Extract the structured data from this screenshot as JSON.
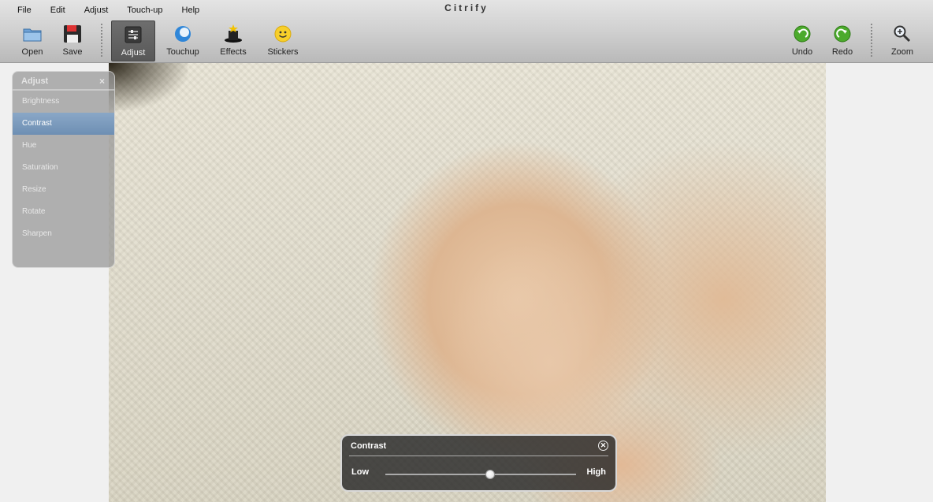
{
  "app": {
    "title": "Citrify"
  },
  "menu": [
    "File",
    "Edit",
    "Adjust",
    "Touch-up",
    "Help"
  ],
  "toolbar": {
    "open": "Open",
    "save": "Save",
    "adjust": "Adjust",
    "touchup": "Touchup",
    "effects": "Effects",
    "stickers": "Stickers",
    "undo": "Undo",
    "redo": "Redo",
    "zoom": "Zoom"
  },
  "adjust_panel": {
    "title": "Adjust",
    "close": "×",
    "items": [
      "Brightness",
      "Contrast",
      "Hue",
      "Saturation",
      "Resize",
      "Rotate",
      "Sharpen"
    ],
    "selected": "Contrast"
  },
  "contrast_dialog": {
    "title": "Contrast",
    "low": "Low",
    "high": "High",
    "value": 0.55
  },
  "colors": {
    "selected_item": "#7a9abd",
    "toolbar": "#cfcfcf"
  }
}
